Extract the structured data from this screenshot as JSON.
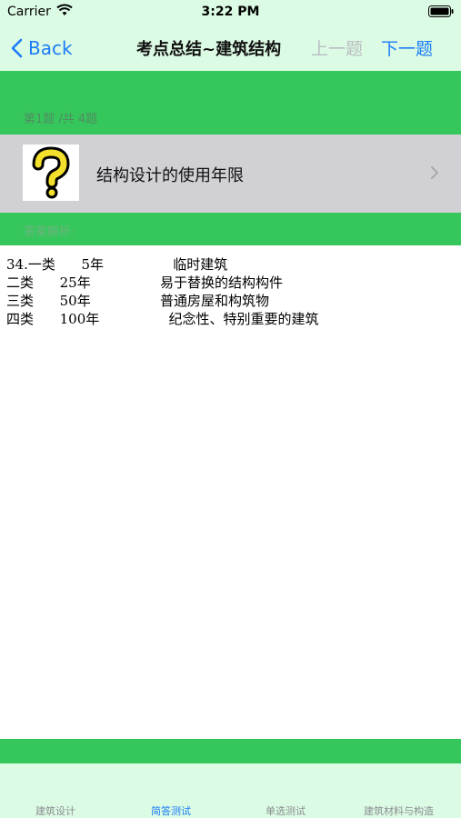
{
  "status_bar": {
    "carrier": "Carrier",
    "time": "3:22 PM"
  },
  "nav": {
    "back_label": "Back",
    "title": "考点总结~建筑结构",
    "prev_label": "上一题",
    "next_label": "下一题"
  },
  "question": {
    "counter": "第1题 /共 4题",
    "text": "结构设计的使用年限",
    "icon": "question-mark-icon"
  },
  "answer": {
    "label": "答案解析:",
    "lines": [
      "34.一类      5年                临时建筑",
      "二类      25年                易于替换的结构构件",
      "三类      50年                普通房屋和构筑物",
      "四类      100年                纪念性、特别重要的建筑"
    ]
  },
  "tabs": [
    {
      "label": "建筑设计",
      "active": false
    },
    {
      "label": "简答测试",
      "active": true
    },
    {
      "label": "单选测试",
      "active": false
    },
    {
      "label": "建筑材料与构造",
      "active": false
    }
  ],
  "colors": {
    "green": "#36c75c",
    "mint": "#dcfbe4",
    "accent_blue": "#1a7cf6",
    "grey_row": "#d0d0d5"
  }
}
